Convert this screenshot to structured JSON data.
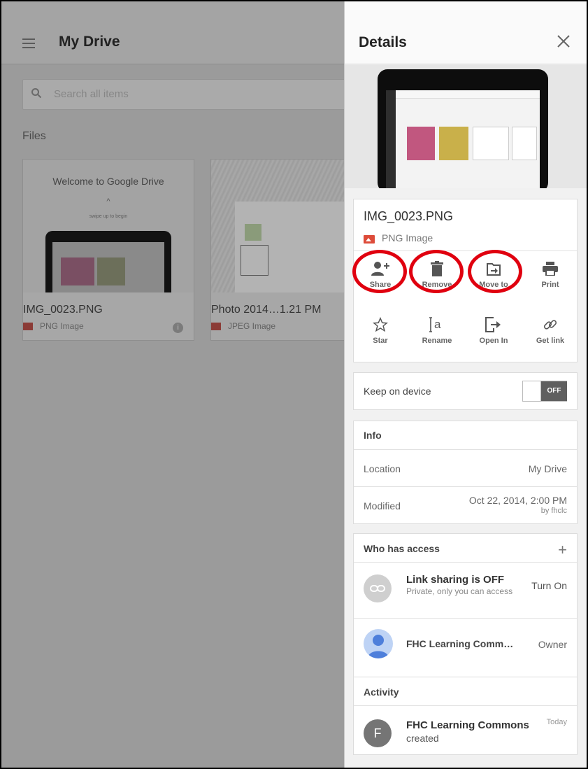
{
  "app": {
    "title": "My Drive"
  },
  "search": {
    "placeholder": "Search all items"
  },
  "files_label": "Files",
  "files": [
    {
      "welcome_title": "Welcome to Google Drive",
      "welcome_hint": "swipe up to begin",
      "name": "IMG_0023.PNG",
      "type": "PNG Image"
    },
    {
      "name": "Photo 2014…1.21 PM",
      "type": "JPEG Image"
    }
  ],
  "details": {
    "title": "Details",
    "file_name": "IMG_0023.PNG",
    "file_type": "PNG Image",
    "actions": [
      {
        "label": "Share",
        "icon": "add-person-icon"
      },
      {
        "label": "Remove",
        "icon": "trash-icon"
      },
      {
        "label": "Move to",
        "icon": "move-folder-icon"
      },
      {
        "label": "Print",
        "icon": "printer-icon"
      },
      {
        "label": "Star",
        "icon": "star-icon"
      },
      {
        "label": "Rename",
        "icon": "rename-icon"
      },
      {
        "label": "Open In",
        "icon": "open-in-icon"
      },
      {
        "label": "Get link",
        "icon": "link-icon"
      }
    ],
    "keep_on_device": {
      "label": "Keep on device",
      "state": "OFF"
    },
    "info": {
      "title": "Info",
      "location_label": "Location",
      "location_value": "My Drive",
      "modified_label": "Modified",
      "modified_value": "Oct 22, 2014, 2:00 PM",
      "modified_by": "by fhclc"
    },
    "access": {
      "title": "Who has access",
      "link_title": "Link sharing is OFF",
      "link_sub": "Private, only you can access",
      "link_action": "Turn On",
      "user_name": "FHC Learning Comm…",
      "user_role": "Owner"
    },
    "activity": {
      "title": "Activity",
      "user": "FHC Learning Commons",
      "action": "created",
      "when": "Today"
    }
  },
  "colors": {
    "highlight": "#e0000f",
    "image_icon": "#dd4b39"
  }
}
